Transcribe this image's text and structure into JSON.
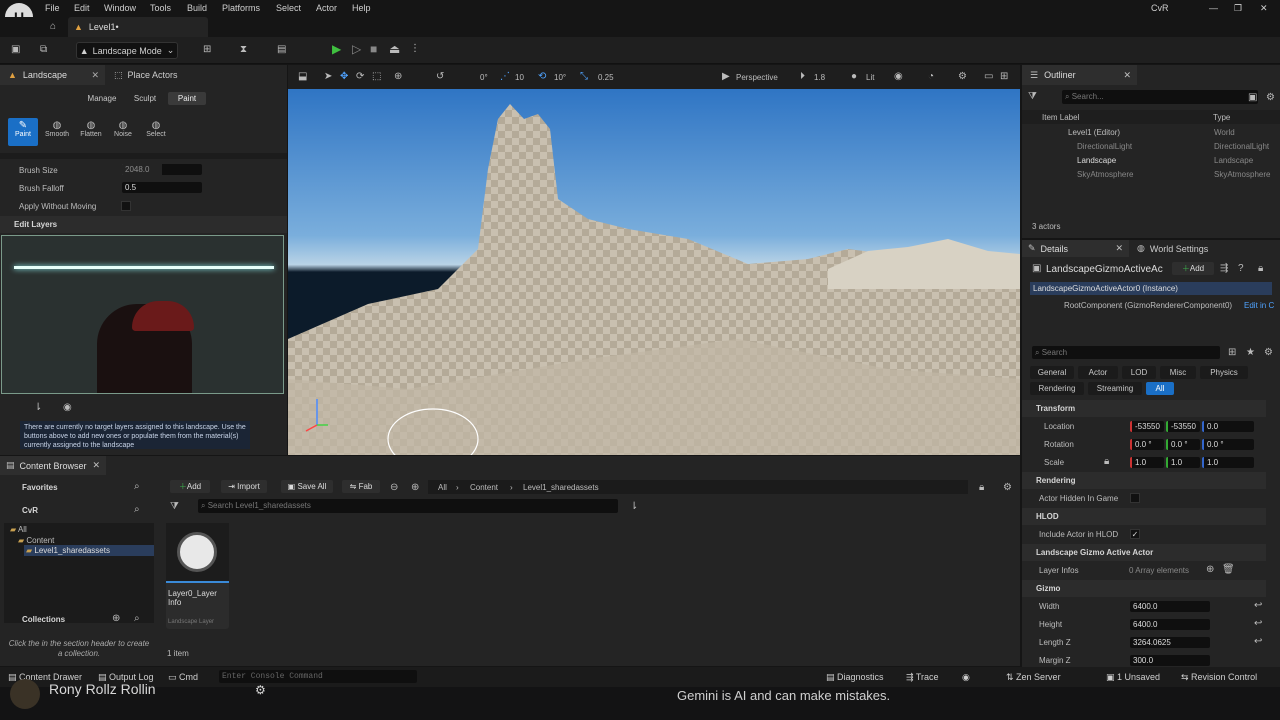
{
  "menu": [
    "File",
    "Edit",
    "Window",
    "Tools",
    "Build",
    "Platforms",
    "Select",
    "Actor",
    "Help"
  ],
  "window": {
    "project": "CvR",
    "level_tab": "Level1•"
  },
  "toolbar": {
    "mode": "Landscape Mode"
  },
  "landscape_panel": {
    "tabs": [
      "Landscape",
      "Place Actors"
    ],
    "mode_tabs": [
      "Manage",
      "Sculpt",
      "Paint"
    ],
    "tools": [
      "Paint",
      "Smooth",
      "Flatten",
      "Noise",
      "Select"
    ],
    "brush_size_label": "Brush Size",
    "brush_size": "2048.0",
    "brush_falloff_label": "Brush Falloff",
    "brush_falloff": "0.5",
    "apply_label": "Apply Without Moving",
    "edit_layers": "Edit Layers",
    "info_message": "There are currently no target layers assigned to this landscape. Use the buttons above to add new ones or populate them from the material(s) currently assigned to the landscape"
  },
  "viewport": {
    "angle": "0°",
    "grid": "10",
    "rot": "10°",
    "scale": "0.25",
    "perspective": "Perspective",
    "fov": "1.8",
    "lit": "Lit"
  },
  "outliner": {
    "title": "Outliner",
    "search_placeholder": "Search...",
    "col_label": "Item Label",
    "col_type": "Type",
    "items": [
      {
        "label": "Level1 (Editor)",
        "type": "World"
      },
      {
        "label": "DirectionalLight",
        "type": "DirectionalLight"
      },
      {
        "label": "Landscape",
        "type": "Landscape"
      },
      {
        "label": "SkyAtmosphere",
        "type": "SkyAtmosphere"
      }
    ],
    "count": "3 actors"
  },
  "details": {
    "tabs": [
      "Details",
      "World Settings"
    ],
    "actor_name": "LandscapeGizmoActiveAc",
    "add": "Add",
    "instance": "LandscapeGizmoActiveActor0 (Instance)",
    "root": "RootComponent (GizmoRendererComponent0)",
    "edit_in": "Edit in C",
    "search": "Search",
    "filters": [
      "General",
      "Actor",
      "LOD",
      "Misc",
      "Physics",
      "Rendering",
      "Streaming",
      "All"
    ],
    "transform": "Transform",
    "location_label": "Location",
    "location": [
      "-53550",
      "-53550",
      "0.0"
    ],
    "rotation_label": "Rotation",
    "rotation": [
      "0.0 °",
      "0.0 °",
      "0.0 °"
    ],
    "scale_label": "Scale",
    "scale": [
      "1.0",
      "1.0",
      "1.0"
    ],
    "rendering": "Rendering",
    "hidden_label": "Actor Hidden In Game",
    "hlod": "HLOD",
    "hlod_label": "Include Actor in HLOD",
    "gizmo_actor": "Landscape Gizmo Active Actor",
    "layer_infos": "Layer Infos",
    "array": "0 Array elements",
    "gizmo": "Gizmo",
    "width_label": "Width",
    "width": "6400.0",
    "height_label": "Height",
    "height": "6400.0",
    "lengthz_label": "Length Z",
    "lengthz": "3264.0625",
    "marginz_label": "Margin Z",
    "marginz": "300.0"
  },
  "content_browser": {
    "title": "Content Browser",
    "favorites": "Favorites",
    "project": "CvR",
    "tree": [
      "All",
      "Content",
      "Level1_sharedassets"
    ],
    "add": "Add",
    "import": "Import",
    "save_all": "Save All",
    "fab": "Fab",
    "path": [
      "All",
      "Content",
      "Level1_sharedassets"
    ],
    "search_placeholder": "Search Level1_sharedassets",
    "asset_name": "Layer0_Layer Info",
    "asset_type": "Landscape Layer",
    "item_count": "1 item",
    "collections": "Collections",
    "collections_hint": "Click the   in the section header to create a collection."
  },
  "statusbar": {
    "drawer": "Content Drawer",
    "output": "Output Log",
    "cmd": "Cmd",
    "console_placeholder": "Enter Console Command",
    "diagnostics": "Diagnostics",
    "trace": "Trace",
    "zen": "Zen Server",
    "unsaved": "1 Unsaved",
    "revision": "Revision Control"
  },
  "overlay": {
    "names": "Rony   Rollz   Rollin",
    "gemini": "Gemini is AI and can make mistakes."
  }
}
